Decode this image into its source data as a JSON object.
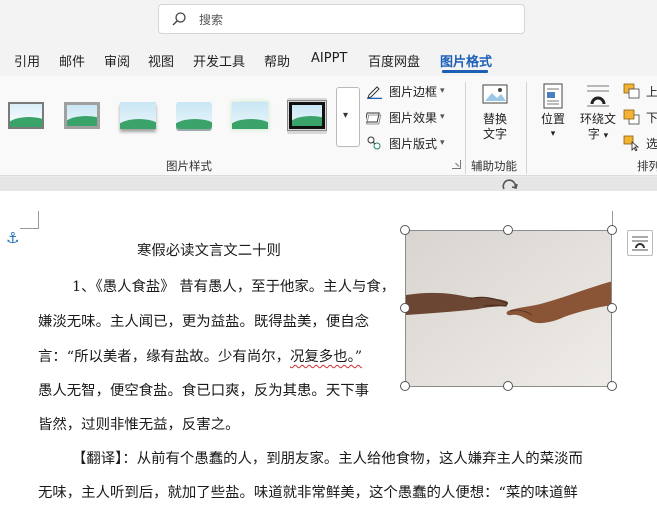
{
  "search": {
    "placeholder": "搜索"
  },
  "tabs": [
    {
      "label": "引用"
    },
    {
      "label": "邮件"
    },
    {
      "label": "审阅"
    },
    {
      "label": "视图"
    },
    {
      "label": "开发工具"
    },
    {
      "label": "帮助"
    },
    {
      "label": "AIPPT"
    },
    {
      "label": "百度网盘"
    },
    {
      "label": "图片格式",
      "active": true
    }
  ],
  "ribbon": {
    "styles_group_label": "图片样式",
    "border_label": "图片边框",
    "effects_label": "图片效果",
    "layout_label": "图片版式",
    "alt_text": {
      "line1": "替换",
      "line2": "文字"
    },
    "accessibility_label": "辅助功能",
    "position_label": "位置",
    "wrap_text": {
      "line1": "环绕文",
      "line2": "字"
    },
    "arrange_label": "排列",
    "bring_forward_label": "上",
    "send_backward_label": "下",
    "selection_label": "选"
  },
  "document": {
    "title": "寒假必读文言文二十则",
    "lines": [
      "1、《愚人食盐》 昔有愚人，至于他家。主人与食，",
      "嫌淡无味。主人闻已，更为益盐。既得盐美，便自念",
      "言：“所以美者，缘有盐故。少有尚尔，",
      "愚人无智，便空食盐。食已口爽，反为其患。天下事",
      "皆然，过则非惟无益，反害之。",
      "【翻译】：从前有个愚蠢的人，到朋友家。主人给他食物，这人嫌弃主人的菜淡而",
      "无味，主人听到后，就加了些盐。味道就非常鲜美，这个愚蠢的人便想：“菜的味道鲜"
    ],
    "squiggle_text": "况复多也。”"
  },
  "colors": {
    "accent": "#1c5fb5",
    "squiggle": "#d03030"
  }
}
